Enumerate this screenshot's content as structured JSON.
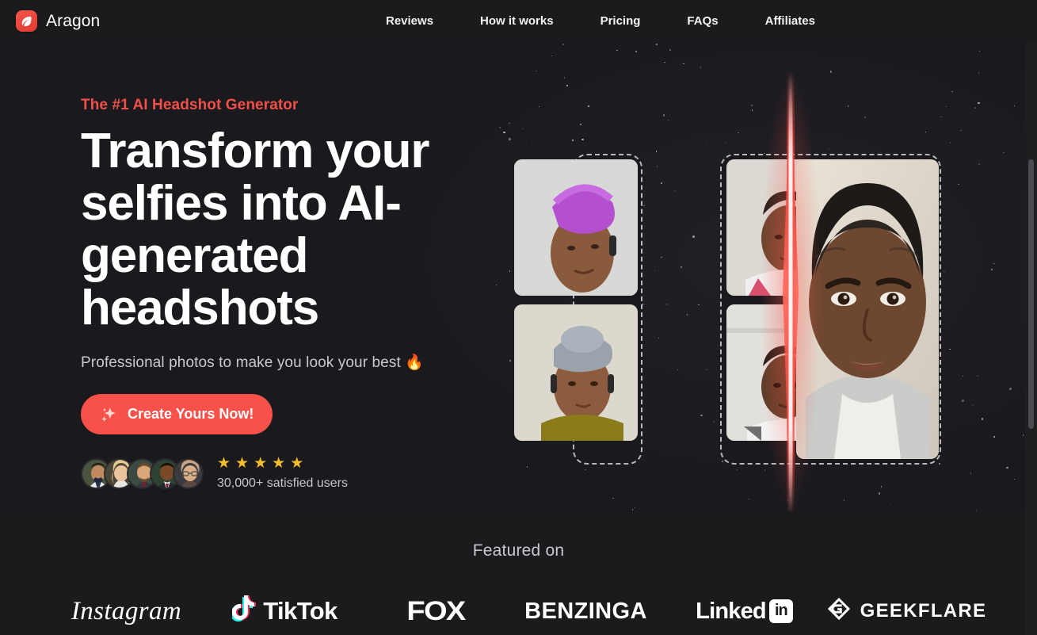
{
  "brand": {
    "name": "Aragon",
    "icon": "leaf-icon",
    "mark_color": "#f4564d"
  },
  "nav": {
    "items": [
      {
        "label": "Reviews"
      },
      {
        "label": "How it works"
      },
      {
        "label": "Pricing"
      },
      {
        "label": "FAQs"
      },
      {
        "label": "Affiliates"
      }
    ]
  },
  "hero": {
    "eyebrow": "The #1 AI Headshot Generator",
    "eyebrow_color": "#f25048",
    "headline": "Transform your selfies into AI-generated headshots",
    "subhead": "Professional photos to make you look your best 🔥",
    "cta": {
      "label": "Create Yours Now!",
      "icon": "sparkle-icon",
      "color": "#f7514a"
    },
    "social_proof": {
      "avatar_count": 5,
      "avatars": [
        {
          "name": "avatar-user-1"
        },
        {
          "name": "avatar-user-2"
        },
        {
          "name": "avatar-user-3"
        },
        {
          "name": "avatar-user-4"
        },
        {
          "name": "avatar-user-5"
        }
      ],
      "stars": 5,
      "star_color": "#f5be2c",
      "users_text": "30,000+ satisfied users"
    },
    "art": {
      "beam_color": "#f4413a",
      "before_cards": 2,
      "selfie_thumbs": 4,
      "result_label": "ai-generated-headshot"
    }
  },
  "featured": {
    "title": "Featured on",
    "logos": [
      {
        "name": "Instagram"
      },
      {
        "name": "TikTok"
      },
      {
        "name": "FOX"
      },
      {
        "name": "BENZINGA"
      },
      {
        "name": "Linked",
        "suffix": "in"
      },
      {
        "name": "GEEKFLARE"
      }
    ]
  },
  "scrollbar": {
    "position": "right"
  }
}
